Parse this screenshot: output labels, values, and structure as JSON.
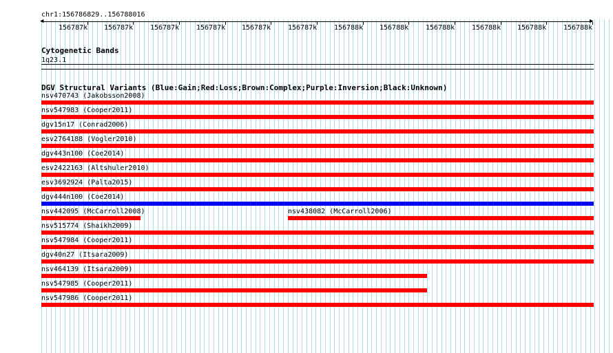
{
  "ruler": {
    "location": "chr1:156786829..156788016",
    "ticks": [
      "156787k",
      "156787k",
      "156787k",
      "156787k",
      "156787k",
      "156787k",
      "156788k",
      "156788k",
      "156788k",
      "156788k",
      "156788k",
      "156788k"
    ]
  },
  "cyto": {
    "title": "Cytogenetic Bands",
    "band": "1q23.1"
  },
  "dgv": {
    "title": "DGV Structural Variants (Blue:Gain;Red:Loss;Brown:Complex;Purple:Inversion;Black:Unknown)",
    "colors": {
      "loss": "#ff0000",
      "gain": "#0000ff"
    },
    "variants": [
      {
        "label": "nsv470743 (Jakobsson2008)",
        "type": "loss",
        "extent": "full"
      },
      {
        "label": "nsv547983 (Cooper2011)",
        "type": "loss",
        "extent": "full"
      },
      {
        "label": "dgv15n17 (Conrad2006)",
        "type": "loss",
        "extent": "full"
      },
      {
        "label": "esv2764188 (Vogler2010)",
        "type": "loss",
        "extent": "full"
      },
      {
        "label": "dgv443n100 (Coe2014)",
        "type": "loss",
        "extent": "full"
      },
      {
        "label": "esv2422163 (Altshuler2010)",
        "type": "loss",
        "extent": "full"
      },
      {
        "label": "esv3692924 (Palta2015)",
        "type": "loss",
        "extent": "full"
      },
      {
        "label": "dgv444n100 (Coe2014)",
        "type": "gain",
        "extent": "full"
      },
      {
        "label": "nsv442095 (McCarroll2008)",
        "type": "loss",
        "extent": "left-short"
      },
      {
        "label": "nsv438082 (McCarroll2006)",
        "type": "loss",
        "extent": "right-half"
      },
      {
        "label": "nsv515774 (Shaikh2009)",
        "type": "loss",
        "extent": "full"
      },
      {
        "label": "nsv547984 (Cooper2011)",
        "type": "loss",
        "extent": "full"
      },
      {
        "label": "dgv40n27 (Itsara2009)",
        "type": "loss",
        "extent": "full"
      },
      {
        "label": "nsv464139 (Itsara2009)",
        "type": "loss",
        "extent": "partial"
      },
      {
        "label": "nsv547985 (Cooper2011)",
        "type": "loss",
        "extent": "partial"
      },
      {
        "label": "nsv547986 (Cooper2011)",
        "type": "loss",
        "extent": "full"
      }
    ]
  }
}
